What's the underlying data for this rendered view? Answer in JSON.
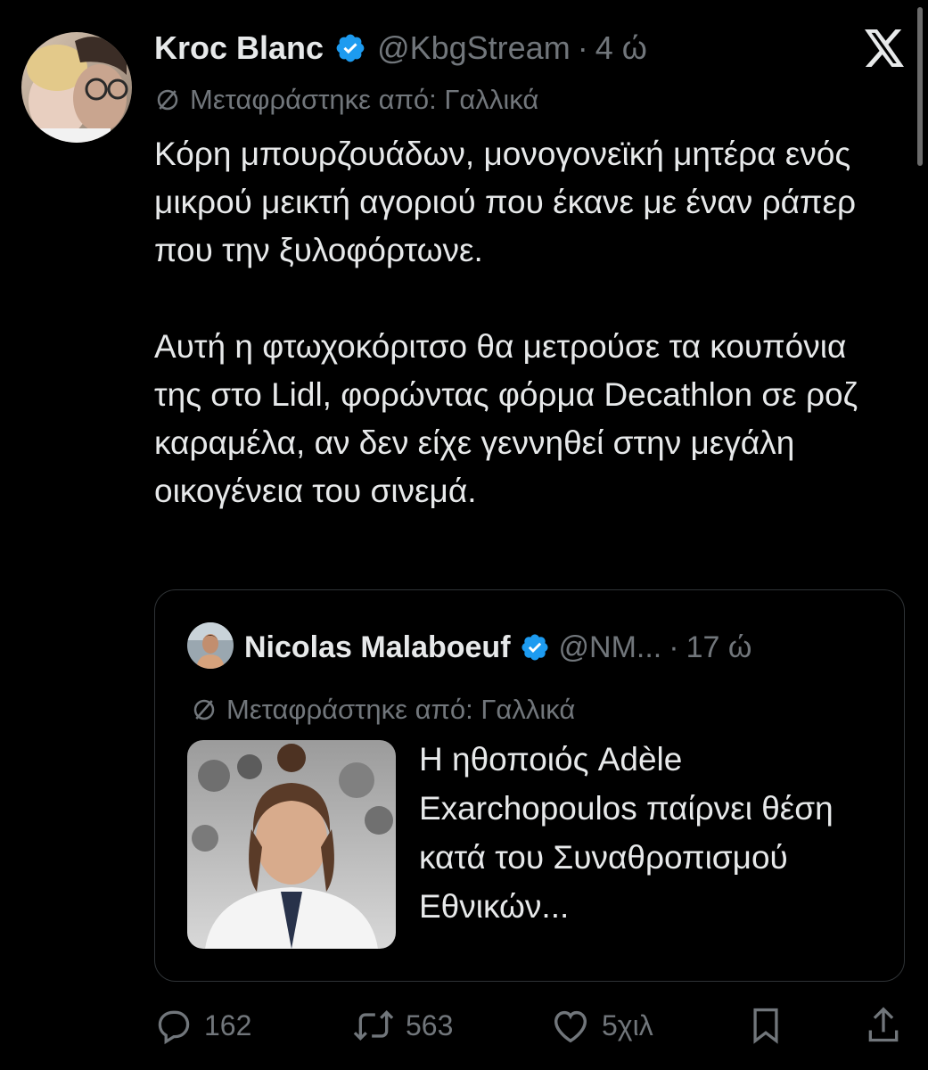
{
  "tweet": {
    "author": {
      "display_name": "Kroc Blanc",
      "handle": "@KbgStream",
      "separator": "·",
      "time": "4 ώ",
      "verified": true
    },
    "translated_label": "Μεταφράστηκε από: Γαλλικά",
    "text_paragraph_1": "Κόρη μπουρζουάδων, μονογονεϊκή μητέρα ενός μικρού μεικτή αγοριού που έκανε με έναν ράπερ που την ξυλοφόρτωνε.",
    "text_paragraph_2": "Αυτή η φτωχοκόριτσο θα μετρούσε τα κουπόνια της στο Lidl, φορώντας φόρμα Decathlon σε ροζ καραμέλα, αν δεν είχε γεννηθεί στην μεγάλη οικογένεια του σινεμά."
  },
  "quote": {
    "author": {
      "display_name": "Nicolas Malaboeuf",
      "handle": "@NM...",
      "separator": "·",
      "time": "17 ώ",
      "verified": true
    },
    "translated_label": "Μεταφράστηκε από: Γαλλικά",
    "text": "Η ηθοποιός Adèle Exarchopoulos παίρνει θέση κατά του Συναθροπισμού Εθνικών..."
  },
  "actions": {
    "replies": "162",
    "reposts": "563",
    "likes": "5χιλ"
  },
  "colors": {
    "background": "#000000",
    "text": "#e7e9ea",
    "secondary_text": "#71767b",
    "verified_blue": "#1d9bf0",
    "border": "#2f3336"
  },
  "icons": [
    "verified-badge-icon",
    "x-logo-icon",
    "translate-icon",
    "reply-icon",
    "repost-icon",
    "like-icon",
    "bookmark-icon",
    "share-icon"
  ]
}
